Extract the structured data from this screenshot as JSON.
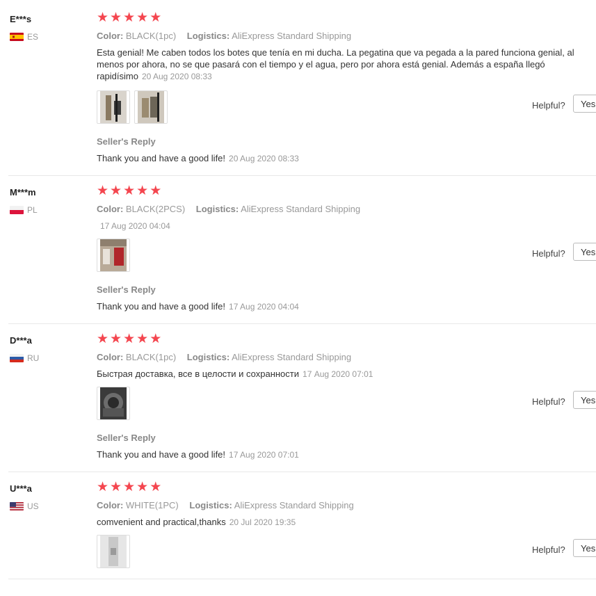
{
  "labels": {
    "color_key": "Color:",
    "logistics_key": "Logistics:",
    "helpful": "Helpful?",
    "yes": "Yes",
    "sellers_reply": "Seller's Reply"
  },
  "colors": {
    "star": "#f4464f",
    "divider": "#e8e8e8",
    "muted": "#999999"
  },
  "reviews": [
    {
      "user": "E***s",
      "country": "ES",
      "flag_icon": "spain-flag-icon",
      "rating": 5,
      "color": "BLACK(1pc)",
      "logistics": "AliExpress Standard Shipping",
      "text": "Esta genial! Me caben todos los botes que tenía en mi ducha. La pegatina que va pegada a la pared funciona genial, al menos por ahora, no se que pasará con el tiempo y el agua, pero por ahora está genial. Además a españa llegó rapidísimo",
      "date": "20 Aug 2020 08:33",
      "photos": 2,
      "reply": "Thank you and have a good life!",
      "reply_date": "20 Aug 2020 08:33"
    },
    {
      "user": "M***m",
      "country": "PL",
      "flag_icon": "poland-flag-icon",
      "rating": 5,
      "color": "BLACK(2PCS)",
      "logistics": "AliExpress Standard Shipping",
      "text": "",
      "date": "17 Aug 2020 04:04",
      "photos": 1,
      "reply": "Thank you and have a good life!",
      "reply_date": "17 Aug 2020 04:04"
    },
    {
      "user": "D***a",
      "country": "RU",
      "flag_icon": "russia-flag-icon",
      "rating": 5,
      "color": "BLACK(1pc)",
      "logistics": "AliExpress Standard Shipping",
      "text": "Быстрая доставка, все в целости и сохранности",
      "date": "17 Aug 2020 07:01",
      "photos": 1,
      "reply": "Thank you and have a good life!",
      "reply_date": "17 Aug 2020 07:01"
    },
    {
      "user": "U***a",
      "country": "US",
      "flag_icon": "us-flag-icon",
      "rating": 5,
      "color": "WHITE(1PC)",
      "logistics": "AliExpress Standard Shipping",
      "text": "comvenient and practical,thanks",
      "date": "20 Jul 2020 19:35",
      "photos": 1
    }
  ]
}
